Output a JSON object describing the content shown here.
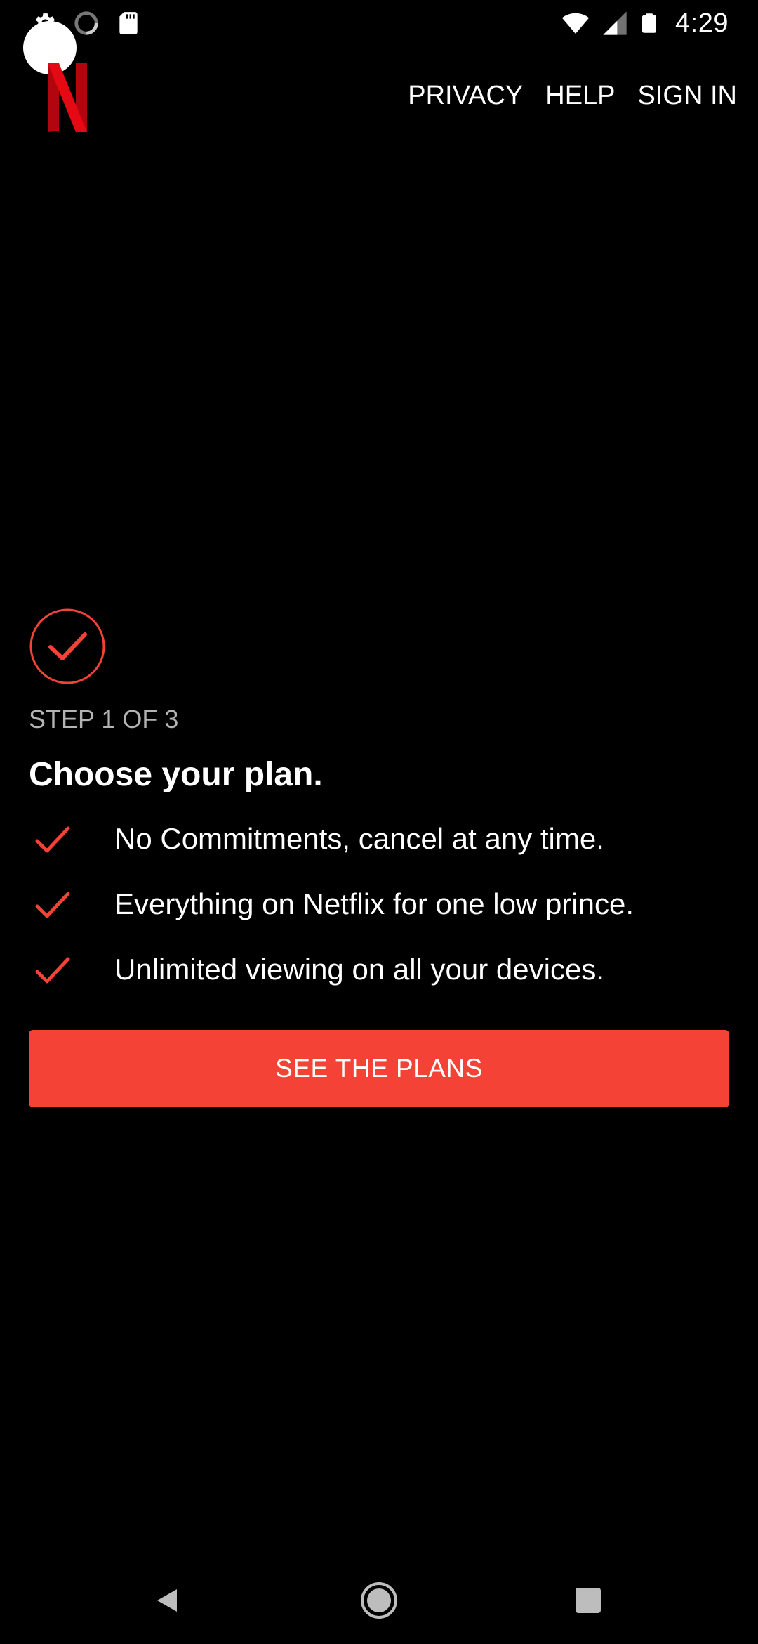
{
  "status_bar": {
    "time": "4:29",
    "left_icons": [
      "settings-gear-icon",
      "loading-spinner-icon",
      "sd-card-icon"
    ],
    "right_icons": [
      "wifi-icon",
      "cell-signal-icon",
      "battery-icon"
    ]
  },
  "brand": {
    "logo_icon": "netflix-n-logo",
    "logo_color": "#e50914"
  },
  "top_nav": {
    "privacy": "PRIVACY",
    "help": "HELP",
    "sign_in": "SIGN IN"
  },
  "onboarding": {
    "step_icon": "check-circle-icon",
    "step_label": "STEP 1 OF 3",
    "title": "Choose your plan.",
    "benefits": [
      "No Commitments, cancel at any time.",
      "Everything on Netflix for one low prince.",
      "Unlimited viewing on all your devices."
    ],
    "cta_label": "SEE THE PLANS"
  },
  "colors": {
    "accent": "#f44336",
    "background": "#000000",
    "text": "#ffffff",
    "muted_text": "#b3b3b3"
  },
  "navigation_bar": {
    "buttons": [
      "back-icon",
      "home-icon",
      "recents-icon"
    ]
  }
}
